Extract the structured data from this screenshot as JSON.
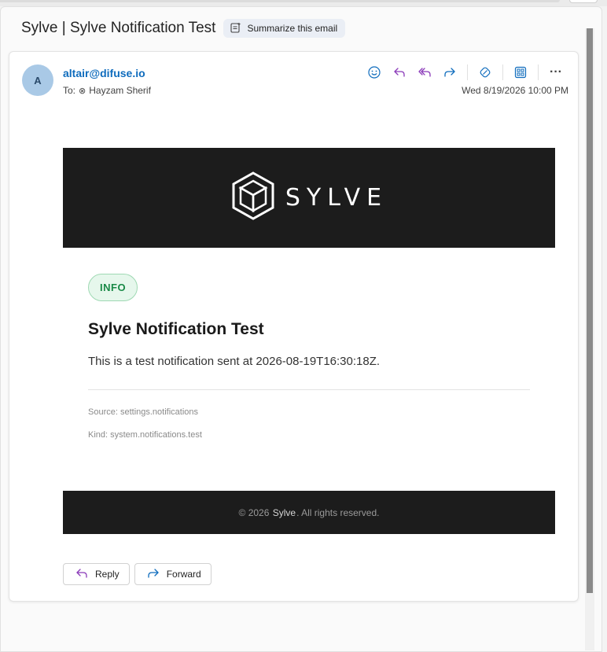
{
  "header": {
    "subject": "Sylve | Sylve Notification Test",
    "summarize_label": "Summarize this email"
  },
  "message": {
    "avatar_initial": "A",
    "sender": "altair@difuse.io",
    "to_prefix": "To:",
    "recipient": "Hayzam Sherif",
    "date": "Wed 8/19/2026 10:00 PM"
  },
  "toolbar": {
    "icons": [
      "smiley-icon",
      "reply-icon",
      "reply-all-icon",
      "forward-icon",
      "loop-icon",
      "apps-icon",
      "more-icon"
    ],
    "more_label": "···"
  },
  "email": {
    "brand_text": "SYLVE",
    "badge": "INFO",
    "headline": "Sylve Notification Test",
    "body": "This is a test notification sent at 2026-08-19T16:30:18Z.",
    "source": "Source: settings.notifications",
    "kind": "Kind: system.notifications.test",
    "footer_prefix": "© 2026",
    "footer_brand": "Sylve",
    "footer_suffix": ". All rights reserved."
  },
  "actions": {
    "reply_label": "Reply",
    "forward_label": "Forward"
  },
  "colors": {
    "accent": "#0f6cbd",
    "banner": "#1c1c1c",
    "badge_green": "#1a8a47",
    "reply_icon_purple": "#8a3ab9"
  }
}
